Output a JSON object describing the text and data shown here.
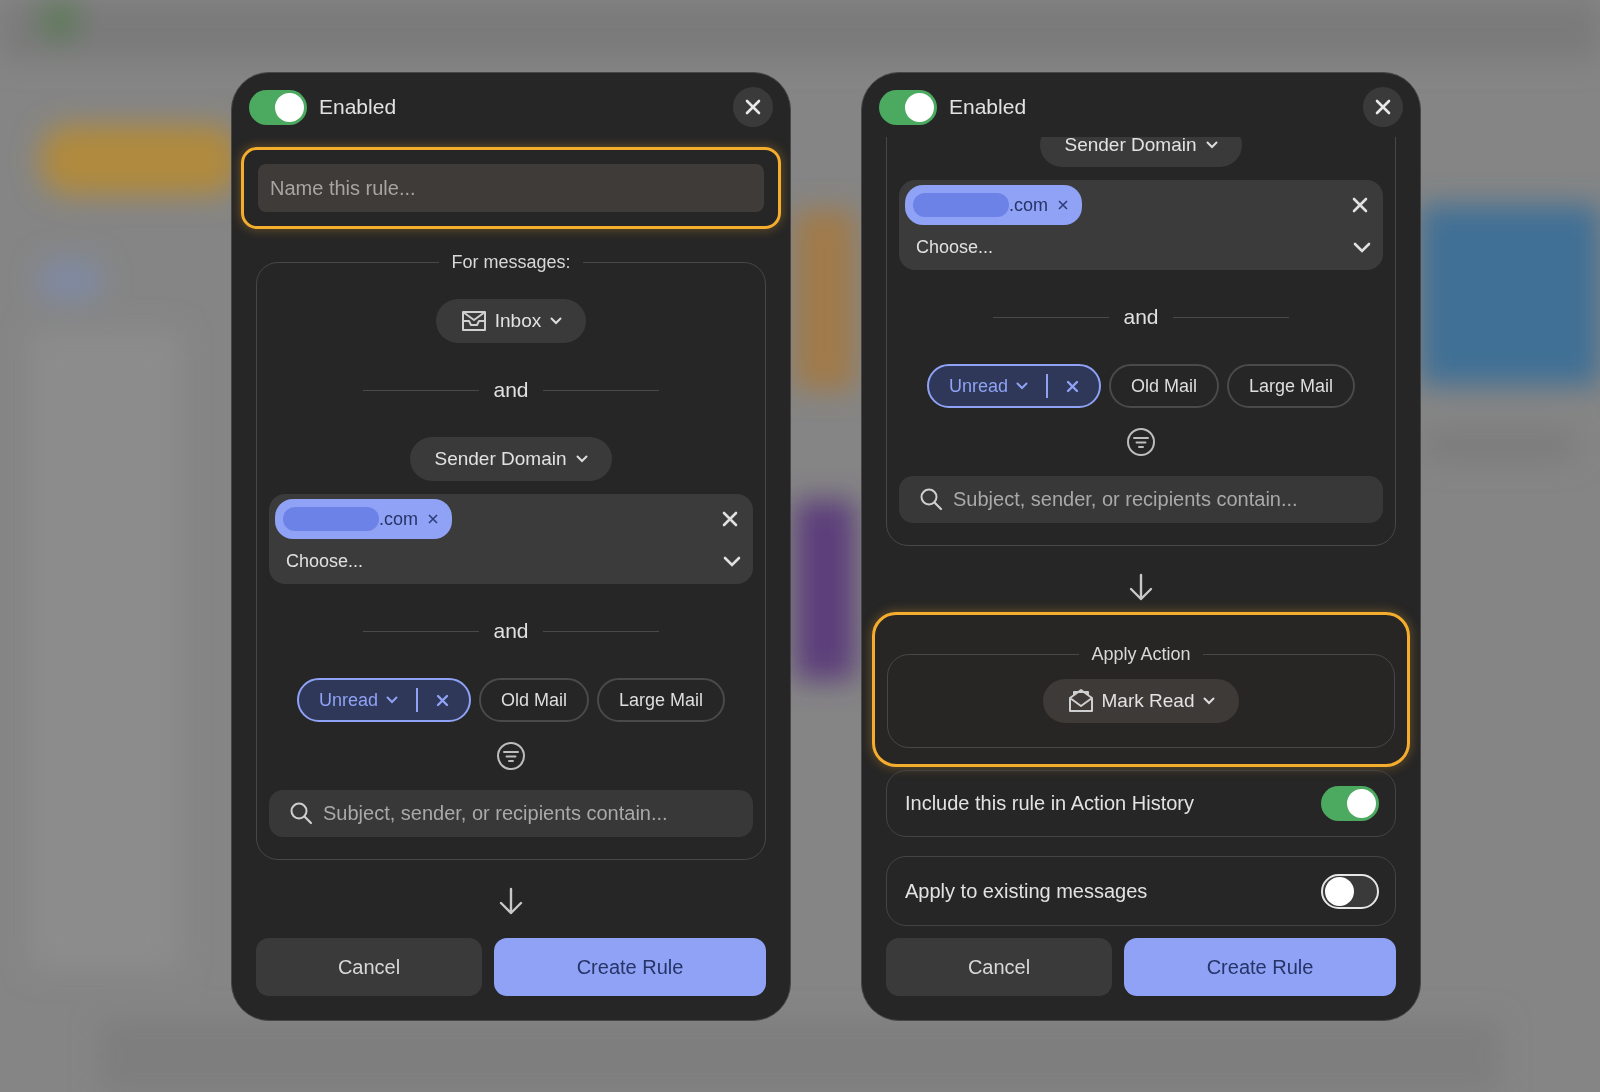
{
  "panels": [
    {
      "enabled": true,
      "enabled_label": "Enabled",
      "scrolled": false,
      "sections": [
        {
          "kind": "name_field",
          "placeholder": "Name this rule...",
          "highlighted": true
        },
        {
          "kind": "group",
          "title": "For messages:",
          "highlighted": false,
          "items": [
            {
              "kind": "inbox_dropdown",
              "label": "Inbox"
            },
            {
              "kind": "separator",
              "label": "and"
            },
            {
              "kind": "dropdown",
              "label": "Sender Domain"
            },
            {
              "kind": "token_box",
              "tokens": [
                ".com"
              ],
              "placeholder": "Choose..."
            },
            {
              "kind": "separator",
              "label": "and"
            },
            {
              "kind": "chips",
              "chips": [
                {
                  "label": "Unread",
                  "selected": true
                },
                {
                  "label": "Old Mail",
                  "selected": false
                },
                {
                  "label": "Large Mail",
                  "selected": false
                }
              ]
            },
            {
              "kind": "filter_button"
            },
            {
              "kind": "search",
              "placeholder": "Subject, sender, or recipients contain..."
            }
          ]
        },
        {
          "kind": "arrow"
        }
      ],
      "buttons": [
        {
          "kind": "secondary",
          "label": "Cancel"
        },
        {
          "kind": "primary",
          "label": "Create Rule"
        }
      ]
    },
    {
      "enabled": true,
      "enabled_label": "Enabled",
      "scrolled": true,
      "sections": [
        {
          "kind": "group",
          "highlighted": false,
          "items": [
            {
              "kind": "dropdown",
              "label": "Sender Domain"
            },
            {
              "kind": "token_box",
              "tokens": [
                ".com"
              ],
              "placeholder": "Choose..."
            },
            {
              "kind": "separator",
              "label": "and"
            },
            {
              "kind": "chips",
              "chips": [
                {
                  "label": "Unread",
                  "selected": true
                },
                {
                  "label": "Old Mail",
                  "selected": false
                },
                {
                  "label": "Large Mail",
                  "selected": false
                }
              ]
            },
            {
              "kind": "filter_button"
            },
            {
              "kind": "search",
              "placeholder": "Subject, sender, or recipients contain..."
            }
          ]
        },
        {
          "kind": "arrow"
        },
        {
          "kind": "group",
          "title": "Apply Action",
          "highlighted": true,
          "items": [
            {
              "kind": "mark_read_dropdown",
              "label": "Mark Read"
            }
          ]
        },
        {
          "kind": "toggle",
          "label": "Include this rule in Action History",
          "on": true
        },
        {
          "kind": "toggle",
          "label": "Apply to existing messages",
          "on": false
        }
      ],
      "buttons": [
        {
          "kind": "secondary",
          "label": "Cancel"
        },
        {
          "kind": "primary",
          "label": "Create Rule"
        }
      ]
    }
  ]
}
